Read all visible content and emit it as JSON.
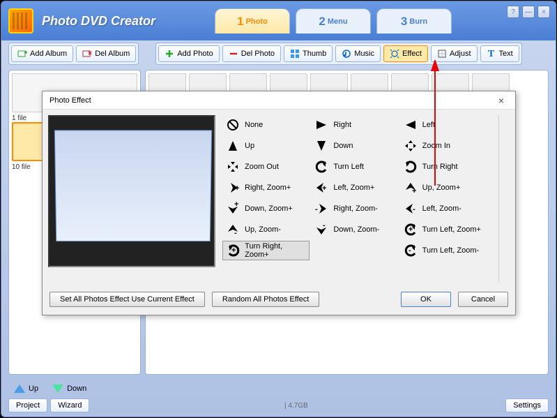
{
  "app": {
    "title": "Photo DVD Creator"
  },
  "windowControls": {
    "help": "?",
    "min": "—",
    "close": "×"
  },
  "steps": [
    {
      "num": "1",
      "label": "Photo"
    },
    {
      "num": "2",
      "label": "Menu"
    },
    {
      "num": "3",
      "label": "Burn"
    }
  ],
  "toolbar": {
    "addAlbum": "Add Album",
    "delAlbum": "Del Album",
    "addPhoto": "Add Photo",
    "delPhoto": "Del Photo",
    "thumb": "Thumb",
    "music": "Music",
    "effect": "Effect",
    "adjust": "Adjust",
    "text": "Text"
  },
  "albums": [
    {
      "label": "1 file"
    },
    {
      "label": "10 file"
    }
  ],
  "navButtons": {
    "up": "Up",
    "down": "Down"
  },
  "statusBar": {
    "project": "Project",
    "wizard": "Wizard",
    "diskSize": "| 4.7GB",
    "settings": "Settings"
  },
  "dialog": {
    "title": "Photo Effect",
    "setAllBtn": "Set All Photos Effect Use Current Effect",
    "randomBtn": "Random All Photos Effect",
    "okBtn": "OK",
    "cancelBtn": "Cancel",
    "effects": [
      {
        "name": "None"
      },
      {
        "name": "Right"
      },
      {
        "name": "Left"
      },
      {
        "name": "Up"
      },
      {
        "name": "Down"
      },
      {
        "name": "Zoom In"
      },
      {
        "name": "Zoom Out"
      },
      {
        "name": "Turn Left"
      },
      {
        "name": "Turn Right"
      },
      {
        "name": "Right, Zoom+"
      },
      {
        "name": "Left, Zoom+"
      },
      {
        "name": "Up, Zoom+"
      },
      {
        "name": "Down, Zoom+"
      },
      {
        "name": "Right, Zoom-"
      },
      {
        "name": "Left, Zoom-"
      },
      {
        "name": "Up, Zoom-"
      },
      {
        "name": "Down, Zoom-"
      },
      {
        "name": "Turn Left, Zoom+"
      },
      {
        "name": "Turn Right, Zoom+"
      },
      {
        "name": ""
      },
      {
        "name": "Turn Left, Zoom-"
      }
    ]
  }
}
